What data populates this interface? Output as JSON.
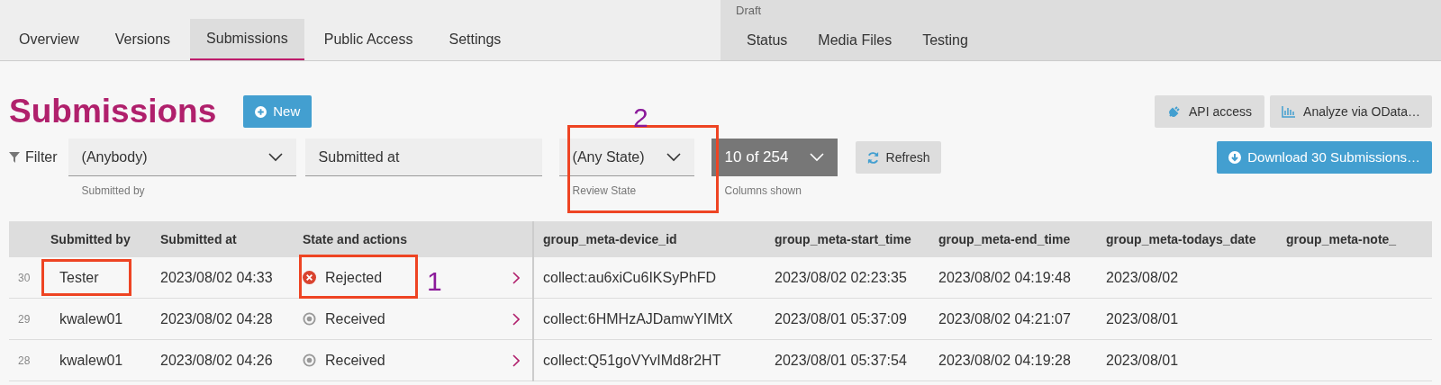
{
  "project_tabs": [
    {
      "label": "Overview",
      "selected": false
    },
    {
      "label": "Versions",
      "selected": false
    },
    {
      "label": "Submissions",
      "selected": true
    },
    {
      "label": "Public Access",
      "selected": false
    },
    {
      "label": "Settings",
      "selected": false
    }
  ],
  "draft": {
    "label": "Draft",
    "tabs": [
      {
        "label": "Status",
        "selected": false
      },
      {
        "label": "Media Files",
        "selected": false
      },
      {
        "label": "Testing",
        "selected": false
      }
    ]
  },
  "heading": "Submissions",
  "new_button": "New",
  "api_button": "API access",
  "odata_button": "Analyze via OData…",
  "filter": {
    "label": "Filter",
    "submitter": {
      "value": "(Anybody)",
      "caption": "Submitted by"
    },
    "date": {
      "placeholder": "Submitted at"
    },
    "state": {
      "value": "(Any State)",
      "caption": "Review State"
    },
    "columns": {
      "value": "10 of 254",
      "caption": "Columns shown"
    }
  },
  "refresh_button": "Refresh",
  "download_button": "Download 30 Submissions…",
  "table": {
    "frozen_columns": [
      "Submitted by",
      "Submitted at",
      "State and actions"
    ],
    "columns": [
      "group_meta-device_id",
      "group_meta-start_time",
      "group_meta-end_time",
      "group_meta-todays_date",
      "group_meta-note_"
    ],
    "rows": [
      {
        "number": "30",
        "submitter": "Tester",
        "submitted_at": "2023/08/02 04:33",
        "state": "Rejected",
        "kind": "rejected",
        "cells": [
          "collect:au6xiCu6IKSyPhFD",
          "2023/08/02 02:23:35",
          "2023/08/02 04:19:48",
          "2023/08/02"
        ]
      },
      {
        "number": "29",
        "submitter": "kwalew01",
        "submitted_at": "2023/08/02 04:28",
        "state": "Received",
        "kind": "received",
        "cells": [
          "collect:6HMHzAJDamwYIMtX",
          "2023/08/01 05:37:09",
          "2023/08/02 04:21:07",
          "2023/08/01"
        ]
      },
      {
        "number": "28",
        "submitter": "kwalew01",
        "submitted_at": "2023/08/02 04:26",
        "state": "Received",
        "kind": "received",
        "cells": [
          "collect:Q51goVYvIMd8r2HT",
          "2023/08/01 05:37:54",
          "2023/08/02 04:19:28",
          "2023/08/01"
        ]
      }
    ]
  },
  "annotations": [
    {
      "label": "1"
    },
    {
      "label": "2"
    }
  ]
}
